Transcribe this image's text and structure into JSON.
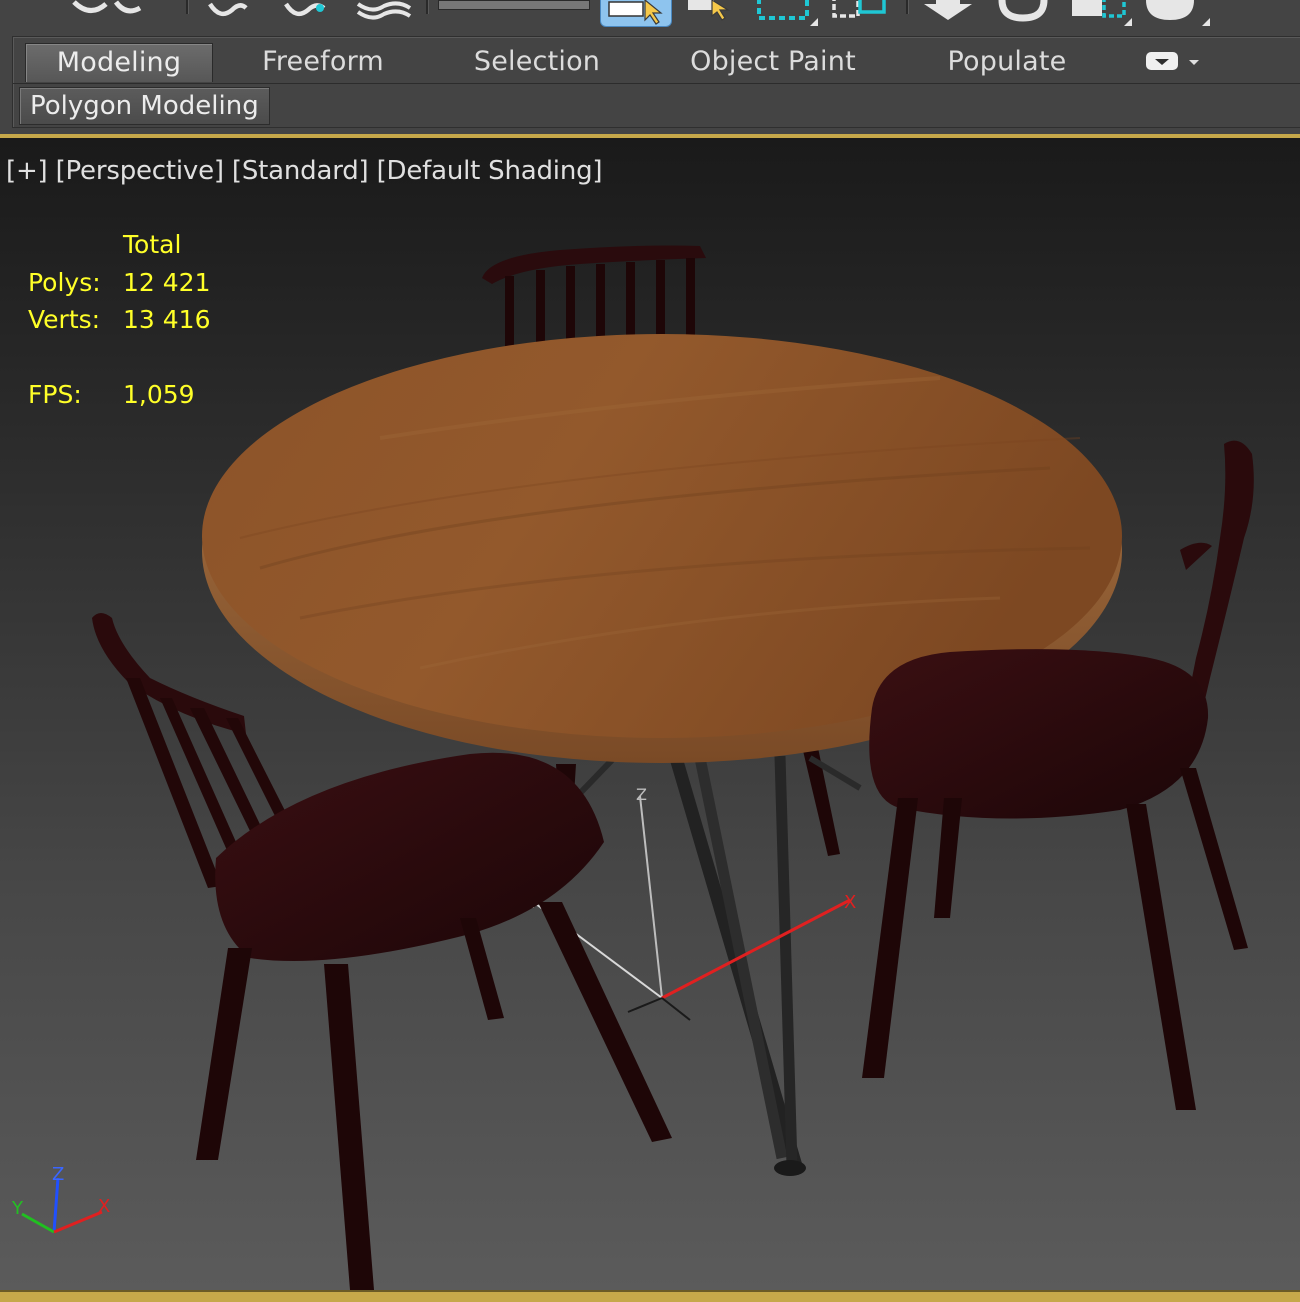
{
  "ribbon": {
    "tabs": [
      {
        "label": "Modeling",
        "active": true
      },
      {
        "label": "Freeform",
        "active": false
      },
      {
        "label": "Selection",
        "active": false
      },
      {
        "label": "Object Paint",
        "active": false
      },
      {
        "label": "Populate",
        "active": false
      }
    ],
    "panel_selector_icon": "dropdown-arrow-icon",
    "panel_label": "Polygon Modeling"
  },
  "toolbar": {
    "icons": [
      "link-icon",
      "unlink-icon",
      "bind-space-warp-icon",
      "select-object-icon",
      "select-by-name-icon",
      "rectangular-selection-region-icon",
      "window-crossing-icon",
      "select-and-move-icon",
      "select-and-rotate-icon",
      "select-and-scale-icon",
      "select-and-place-icon"
    ]
  },
  "viewport": {
    "labels": [
      "[+]",
      "[Perspective]",
      "[Standard]",
      "[Default Shading]"
    ],
    "stats": {
      "header": "Total",
      "polys_label": "Polys:",
      "polys_value": "12 421",
      "verts_label": "Verts:",
      "verts_value": "13 416",
      "fps_label": "FPS:",
      "fps_value": "1,059"
    },
    "gizmo_labels": {
      "x": "X",
      "y": "Y",
      "z": "Z"
    },
    "axis_tripod_labels": {
      "x": "X",
      "y": "Y",
      "z": "Z"
    }
  },
  "colors": {
    "accent": "#c6a84a",
    "stats_text": "#ffff28",
    "axis_x": "#e02020",
    "axis_y": "#20c020",
    "axis_z": "#2050ff",
    "tabletop": "#8a5228",
    "chair": "#2a0a0c"
  }
}
